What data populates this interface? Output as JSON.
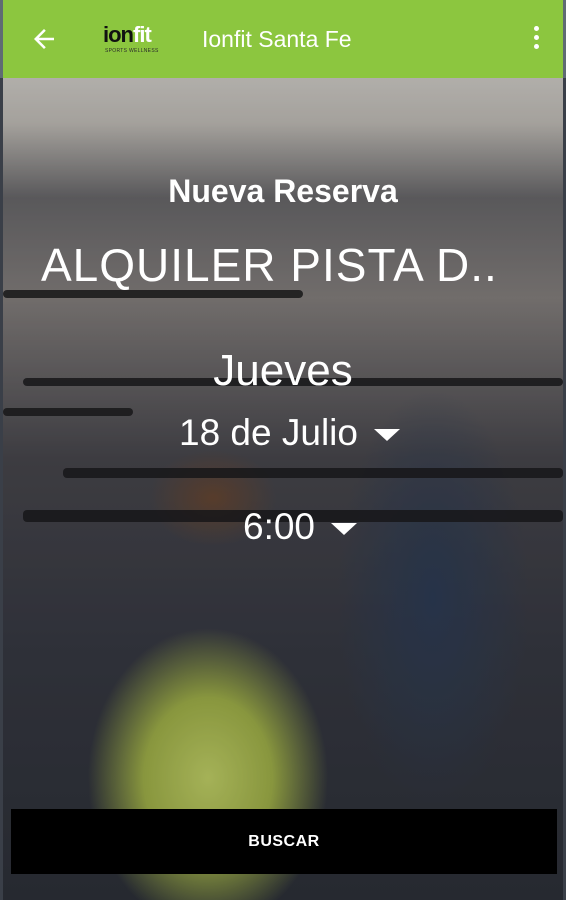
{
  "app": {
    "title": "Ionfit Santa Fe",
    "logo_text_ion": "ion",
    "logo_text_fit": "fit",
    "logo_tagline": "SPORTS WELLNESS",
    "brand_color": "#8cc63f"
  },
  "toolbar": {
    "back_icon": "arrow-left-icon",
    "menu_icon": "more-vertical-icon"
  },
  "reservation": {
    "heading": "Nueva Reserva",
    "activity": "ALQUILER PISTA D..",
    "day_name": "Jueves",
    "date": "18 de Julio",
    "time": "6:00"
  },
  "actions": {
    "search_label": "BUSCAR"
  }
}
